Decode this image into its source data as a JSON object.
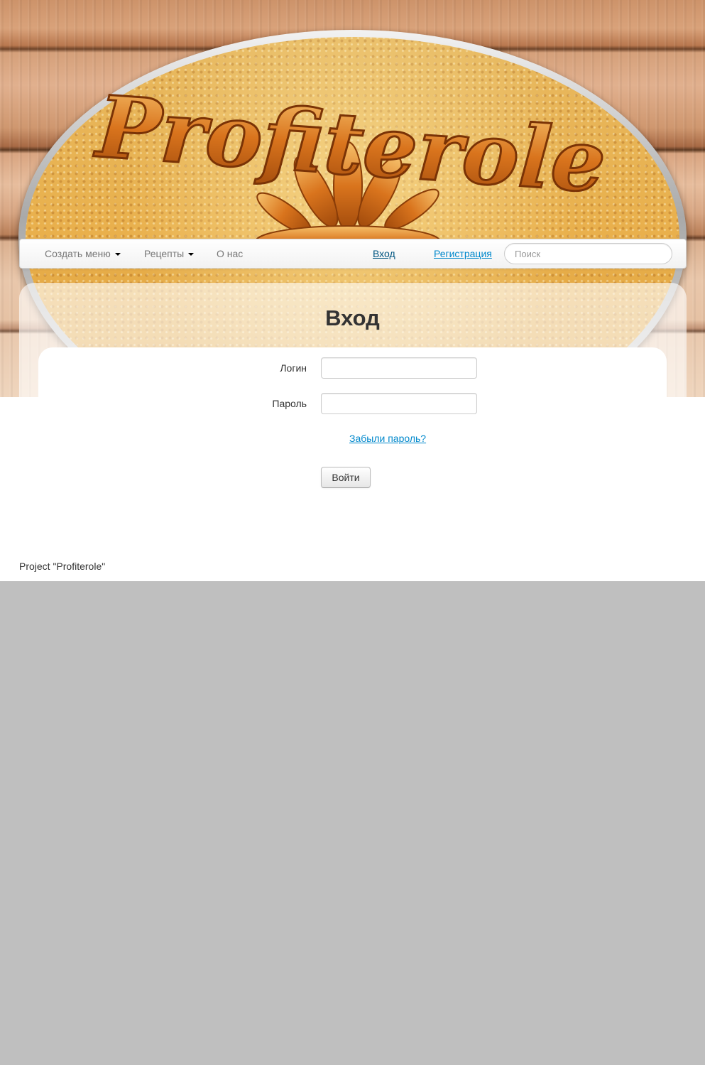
{
  "header": {
    "logo_text": "Profiterole"
  },
  "nav": {
    "items": [
      {
        "label": "Создать меню",
        "dropdown": true
      },
      {
        "label": "Рецепты",
        "dropdown": true
      },
      {
        "label": "О нас",
        "dropdown": false
      }
    ],
    "login_link": "Вход",
    "register_link": "Регистрация",
    "search_placeholder": "Поиск"
  },
  "login": {
    "title": "Вход",
    "username_label": "Логин",
    "username_value": "",
    "password_label": "Пароль",
    "password_value": "",
    "forgot_link": "Забыли пароль?",
    "submit_label": "Войти"
  },
  "footer": {
    "text": "Project \"Profiterole\""
  },
  "colors": {
    "link": "#0088cc",
    "link_active": "#005580",
    "page_bg": "#bfbfbf"
  }
}
